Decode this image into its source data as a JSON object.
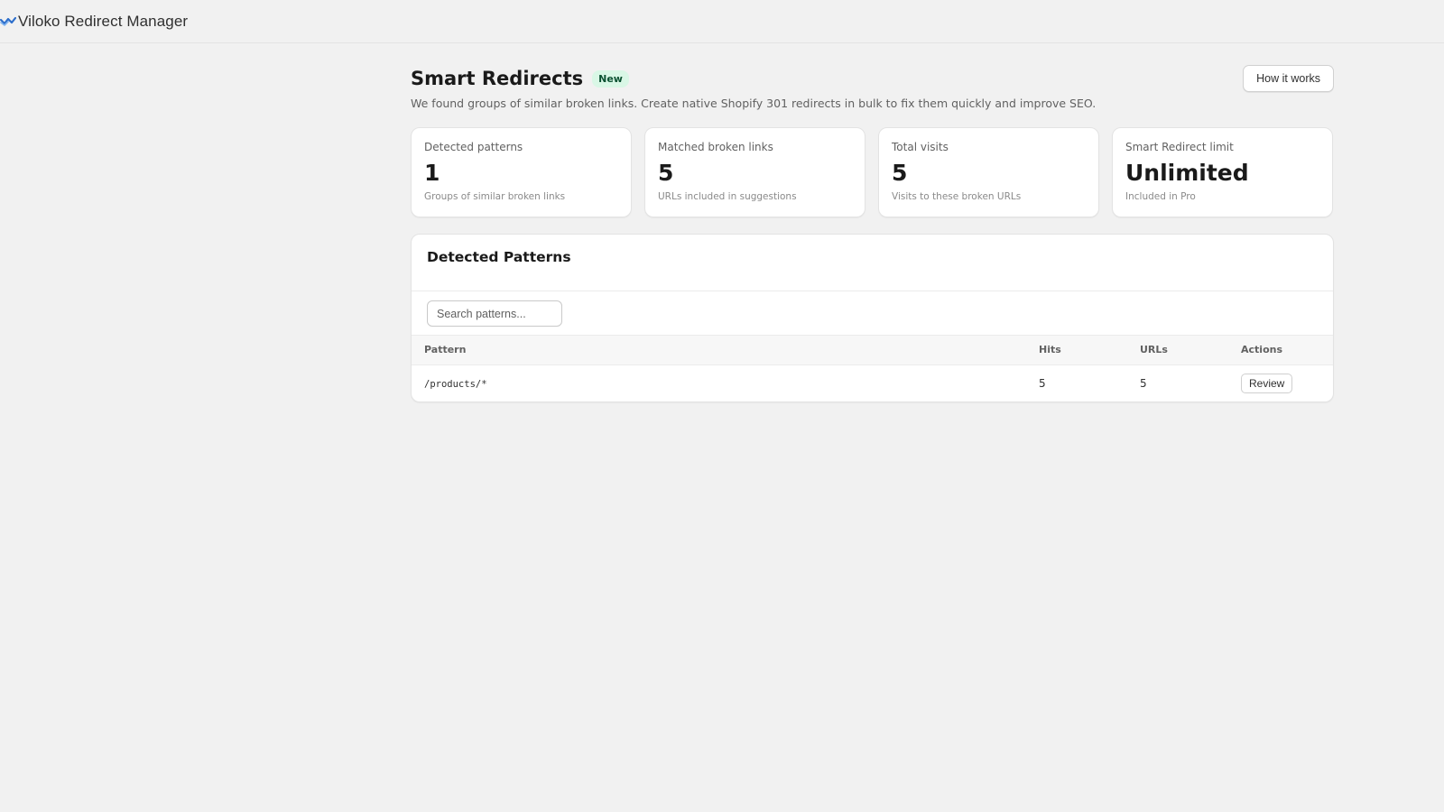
{
  "app": {
    "title": "Viloko Redirect Manager",
    "logo_icon": "wave-check-logo-icon",
    "accent": "#2c6ecb"
  },
  "header": {
    "title": "Smart Redirects",
    "badge": "New",
    "subtitle": "We found groups of similar broken links. Create native Shopify 301 redirects in bulk to fix them quickly and improve SEO.",
    "how_button": "How it works"
  },
  "stats": [
    {
      "label": "Detected patterns",
      "value": "1",
      "caption": "Groups of similar broken links"
    },
    {
      "label": "Matched broken links",
      "value": "5",
      "caption": "URLs included in suggestions"
    },
    {
      "label": "Total visits",
      "value": "5",
      "caption": "Visits to these broken URLs"
    },
    {
      "label": "Smart Redirect limit",
      "value": "Unlimited",
      "caption": "Included in Pro"
    }
  ],
  "patterns": {
    "title": "Detected Patterns",
    "search_placeholder": "Search patterns...",
    "columns": {
      "pattern": "Pattern",
      "hits": "Hits",
      "urls": "URLs",
      "actions": "Actions"
    },
    "rows": [
      {
        "pattern": "/products/*",
        "hits": "5",
        "urls": "5",
        "action": "Review"
      }
    ]
  }
}
